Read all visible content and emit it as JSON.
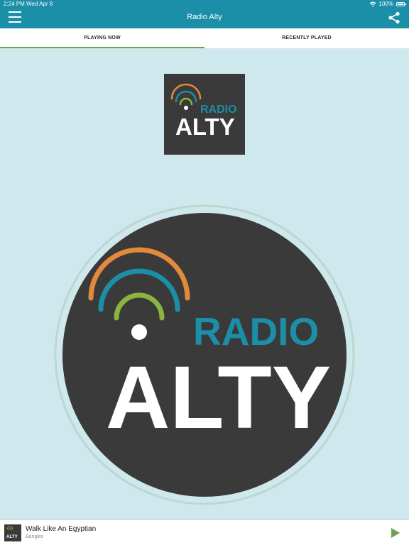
{
  "status_bar": {
    "time": "2:24 PM",
    "date": "Wed Apr 8",
    "battery": "100%"
  },
  "header": {
    "title": "Radio Alty",
    "menu_icon": "hamburger-menu-icon",
    "share_icon": "share-icon",
    "background": "#1b8ea8"
  },
  "tabs": [
    {
      "label": "PLAYING NOW",
      "active": true
    },
    {
      "label": "RECENTLY PLAYED",
      "active": false
    }
  ],
  "logo": {
    "line1": "RADIO",
    "line2": "ALTY",
    "arc_colors": [
      "#e3893c",
      "#1b8ea8",
      "#8ab43f"
    ],
    "line1_color": "#1b8ea8",
    "line2_color": "#ffffff",
    "background": "#3a3a3a"
  },
  "player": {
    "track": "Walk Like An Egyptian",
    "artist": "Bangles",
    "thumb_text": "ALTY",
    "play_icon": "play-icon",
    "accent": "#6fa056"
  }
}
